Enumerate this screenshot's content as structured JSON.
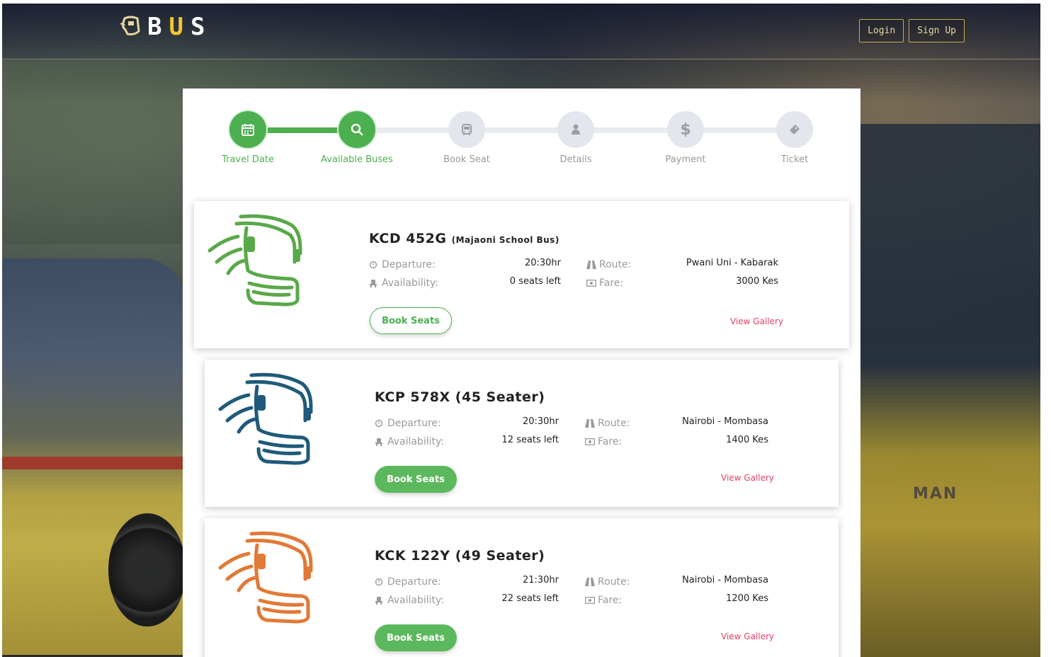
{
  "brand": {
    "letters": [
      "B",
      "U",
      "S"
    ]
  },
  "auth": {
    "login": "Login",
    "signup": "Sign Up"
  },
  "steps": [
    {
      "label": "Travel Date",
      "icon": "calendar-icon",
      "state": "done"
    },
    {
      "label": "Available Buses",
      "icon": "search-icon",
      "state": "done"
    },
    {
      "label": "Book Seat",
      "icon": "bus-icon",
      "state": "todo"
    },
    {
      "label": "Details",
      "icon": "user-icon",
      "state": "todo"
    },
    {
      "label": "Payment",
      "icon": "dollar-icon",
      "state": "todo"
    },
    {
      "label": "Ticket",
      "icon": "ticket-icon",
      "state": "todo"
    }
  ],
  "labels": {
    "departure": "Departure:",
    "availability": "Availability:",
    "route": "Route:",
    "fare": "Fare:",
    "book": "Book Seats",
    "gallery": "View Gallery"
  },
  "buses": [
    {
      "plate": "KCD 452G",
      "name": "(Majaoni School Bus)",
      "departure": "20:30hr",
      "availability": "0 seats left",
      "route": "Pwani Uni - Kabarak",
      "fare": "3000 Kes",
      "color": "#5aa84a",
      "book_style": "outline"
    },
    {
      "plate": "KCP 578X",
      "name": "(45 Seater)",
      "departure": "20:30hr",
      "availability": "12 seats left",
      "route": "Nairobi - Mombasa",
      "fare": "1400 Kes",
      "color": "#1f5a7a",
      "book_style": "filled"
    },
    {
      "plate": "KCK 122Y",
      "name": "(49 Seater)",
      "departure": "21:30hr",
      "availability": "22 seats left",
      "route": "Nairobi - Mombasa",
      "fare": "1200 Kes",
      "color": "#e07a36",
      "book_style": "filled"
    }
  ],
  "background": {
    "bus_brand": "MAN"
  },
  "colors": {
    "accent": "#4caf50",
    "gold": "#f4c430",
    "link": "#e83e6c"
  }
}
